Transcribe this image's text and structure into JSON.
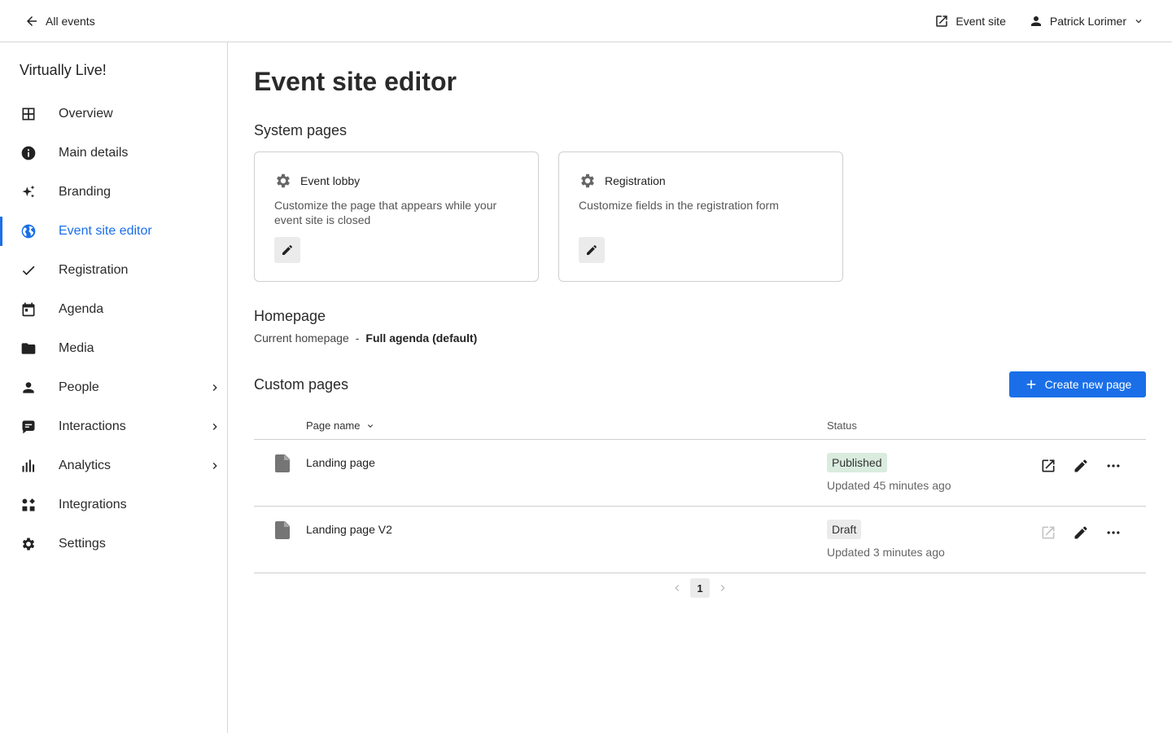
{
  "topbar": {
    "back_label": "All events",
    "event_site_label": "Event site",
    "user_name": "Patrick Lorimer"
  },
  "sidebar": {
    "event_name": "Virtually Live!",
    "items": [
      {
        "label": "Overview",
        "icon": "grid-icon"
      },
      {
        "label": "Main details",
        "icon": "info-icon"
      },
      {
        "label": "Branding",
        "icon": "sparkle-icon"
      },
      {
        "label": "Event site editor",
        "icon": "globe-icon",
        "active": true
      },
      {
        "label": "Registration",
        "icon": "check-icon"
      },
      {
        "label": "Agenda",
        "icon": "calendar-icon"
      },
      {
        "label": "Media",
        "icon": "folder-icon"
      },
      {
        "label": "People",
        "icon": "person-icon",
        "has_submenu": true
      },
      {
        "label": "Interactions",
        "icon": "chat-icon",
        "has_submenu": true
      },
      {
        "label": "Analytics",
        "icon": "bar-chart-icon",
        "has_submenu": true
      },
      {
        "label": "Integrations",
        "icon": "apps-icon"
      },
      {
        "label": "Settings",
        "icon": "gear-icon"
      }
    ]
  },
  "main": {
    "title": "Event site editor",
    "system_pages": {
      "title": "System pages",
      "cards": [
        {
          "title": "Event lobby",
          "description": "Customize the page that appears while your event site is closed",
          "icon": "gear-icon"
        },
        {
          "title": "Registration",
          "description": "Customize fields in the registration form",
          "icon": "gear-icon"
        }
      ]
    },
    "homepage": {
      "title": "Homepage",
      "label": "Current homepage",
      "separator": "-",
      "value": "Full agenda (default)"
    },
    "custom_pages": {
      "title": "Custom pages",
      "create_button": "Create new page",
      "columns": {
        "name": "Page name",
        "status": "Status"
      },
      "rows": [
        {
          "name": "Landing page",
          "status": "Published",
          "updated": "Updated 45 minutes ago",
          "open_enabled": true
        },
        {
          "name": "Landing page V2",
          "status": "Draft",
          "updated": "Updated 3 minutes ago",
          "open_enabled": false
        }
      ],
      "pagination": {
        "current_page": "1"
      }
    }
  },
  "colors": {
    "accent": "#1a6fe8",
    "published_badge": "#d9ecde",
    "draft_badge": "#ebebeb",
    "border": "#d6d6d6"
  }
}
